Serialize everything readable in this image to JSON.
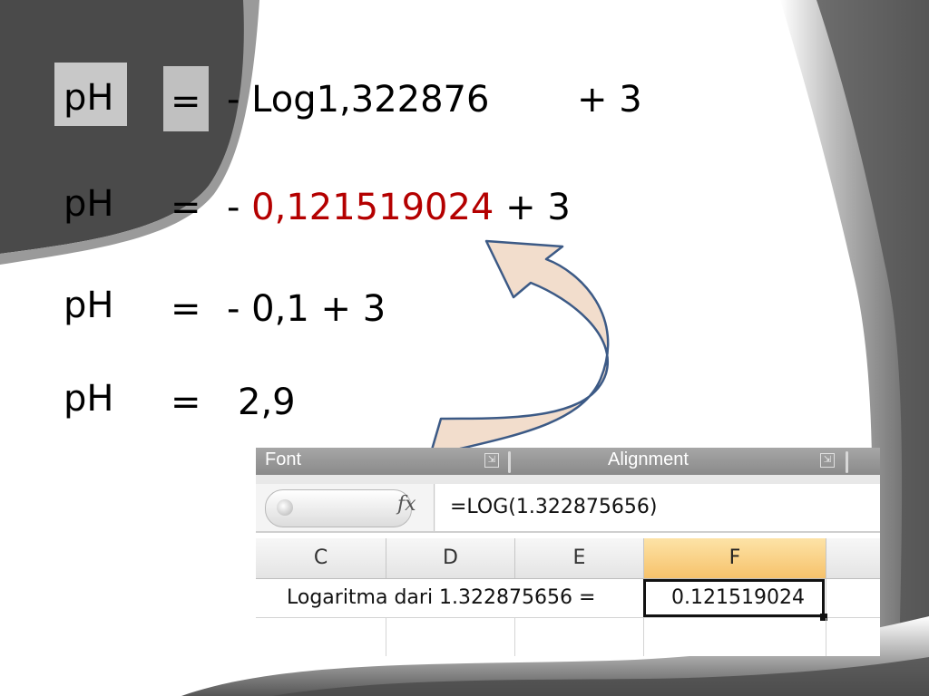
{
  "equations": [
    {
      "label": "pH",
      "eq": "=",
      "rhs_parts": [
        {
          "text": "- Log1,322876",
          "color": "#000000"
        },
        {
          "text": "+ 3",
          "color": "#000000"
        }
      ]
    },
    {
      "label": "pH",
      "eq": "=",
      "rhs_parts": [
        {
          "text": "- ",
          "color": "#000000"
        },
        {
          "text": "0,121519024",
          "color": "#b40000"
        },
        {
          "text": " + 3",
          "color": "#000000"
        }
      ]
    },
    {
      "label": "pH",
      "eq": "=",
      "rhs_parts": [
        {
          "text": "- 0,1 + 3",
          "color": "#000000"
        }
      ]
    },
    {
      "label": "pH",
      "eq": "=",
      "rhs_parts": [
        {
          "text": "2,9",
          "color": "#000000"
        }
      ]
    }
  ],
  "excel": {
    "ribbon": {
      "group_font": "Font",
      "group_alignment": "Alignment"
    },
    "fx_icon": "fx-icon",
    "formula": "=LOG(1.322875656)",
    "columns": [
      "C",
      "D",
      "E",
      "F"
    ],
    "selected_column": "F",
    "row1": {
      "label_text": "Logaritma dari 1.322875656 =",
      "result": "0.121519024"
    }
  },
  "colors": {
    "highlight_red": "#b40000",
    "arrow_fill": "#f2ddcc",
    "arrow_stroke": "#3c5a86"
  }
}
